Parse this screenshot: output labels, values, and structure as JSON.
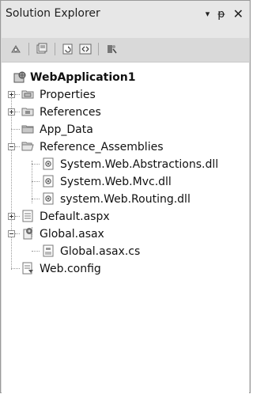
{
  "panel": {
    "title": "Solution Explorer",
    "controls": {
      "dropdown": "▾",
      "pin": "ᵽ",
      "close": "✕"
    }
  },
  "toolbar": {
    "buttons": [
      "properties-icon",
      "show-all-files-icon",
      "refresh-icon",
      "view-code-icon",
      "copy-website-icon"
    ]
  },
  "tree": {
    "items": [
      {
        "label": "WebApplication1",
        "icon": "web-project-icon",
        "bold": true
      },
      {
        "label": "Properties",
        "icon": "properties-folder-icon"
      },
      {
        "label": "References",
        "icon": "references-folder-icon"
      },
      {
        "label": "App_Data",
        "icon": "folder-icon"
      },
      {
        "label": "Reference_Assemblies",
        "icon": "open-folder-icon"
      },
      {
        "label": "System.Web.Abstractions.dll",
        "icon": "dll-file-icon"
      },
      {
        "label": "System.Web.Mvc.dll",
        "icon": "dll-file-icon"
      },
      {
        "label": "system.Web.Routing.dll",
        "icon": "dll-file-icon"
      },
      {
        "label": "Default.aspx",
        "icon": "aspx-file-icon"
      },
      {
        "label": "Global.asax",
        "icon": "asax-file-icon"
      },
      {
        "label": "Global.asax.cs",
        "icon": "cs-file-icon"
      },
      {
        "label": "Web.config",
        "icon": "config-file-icon"
      }
    ]
  }
}
